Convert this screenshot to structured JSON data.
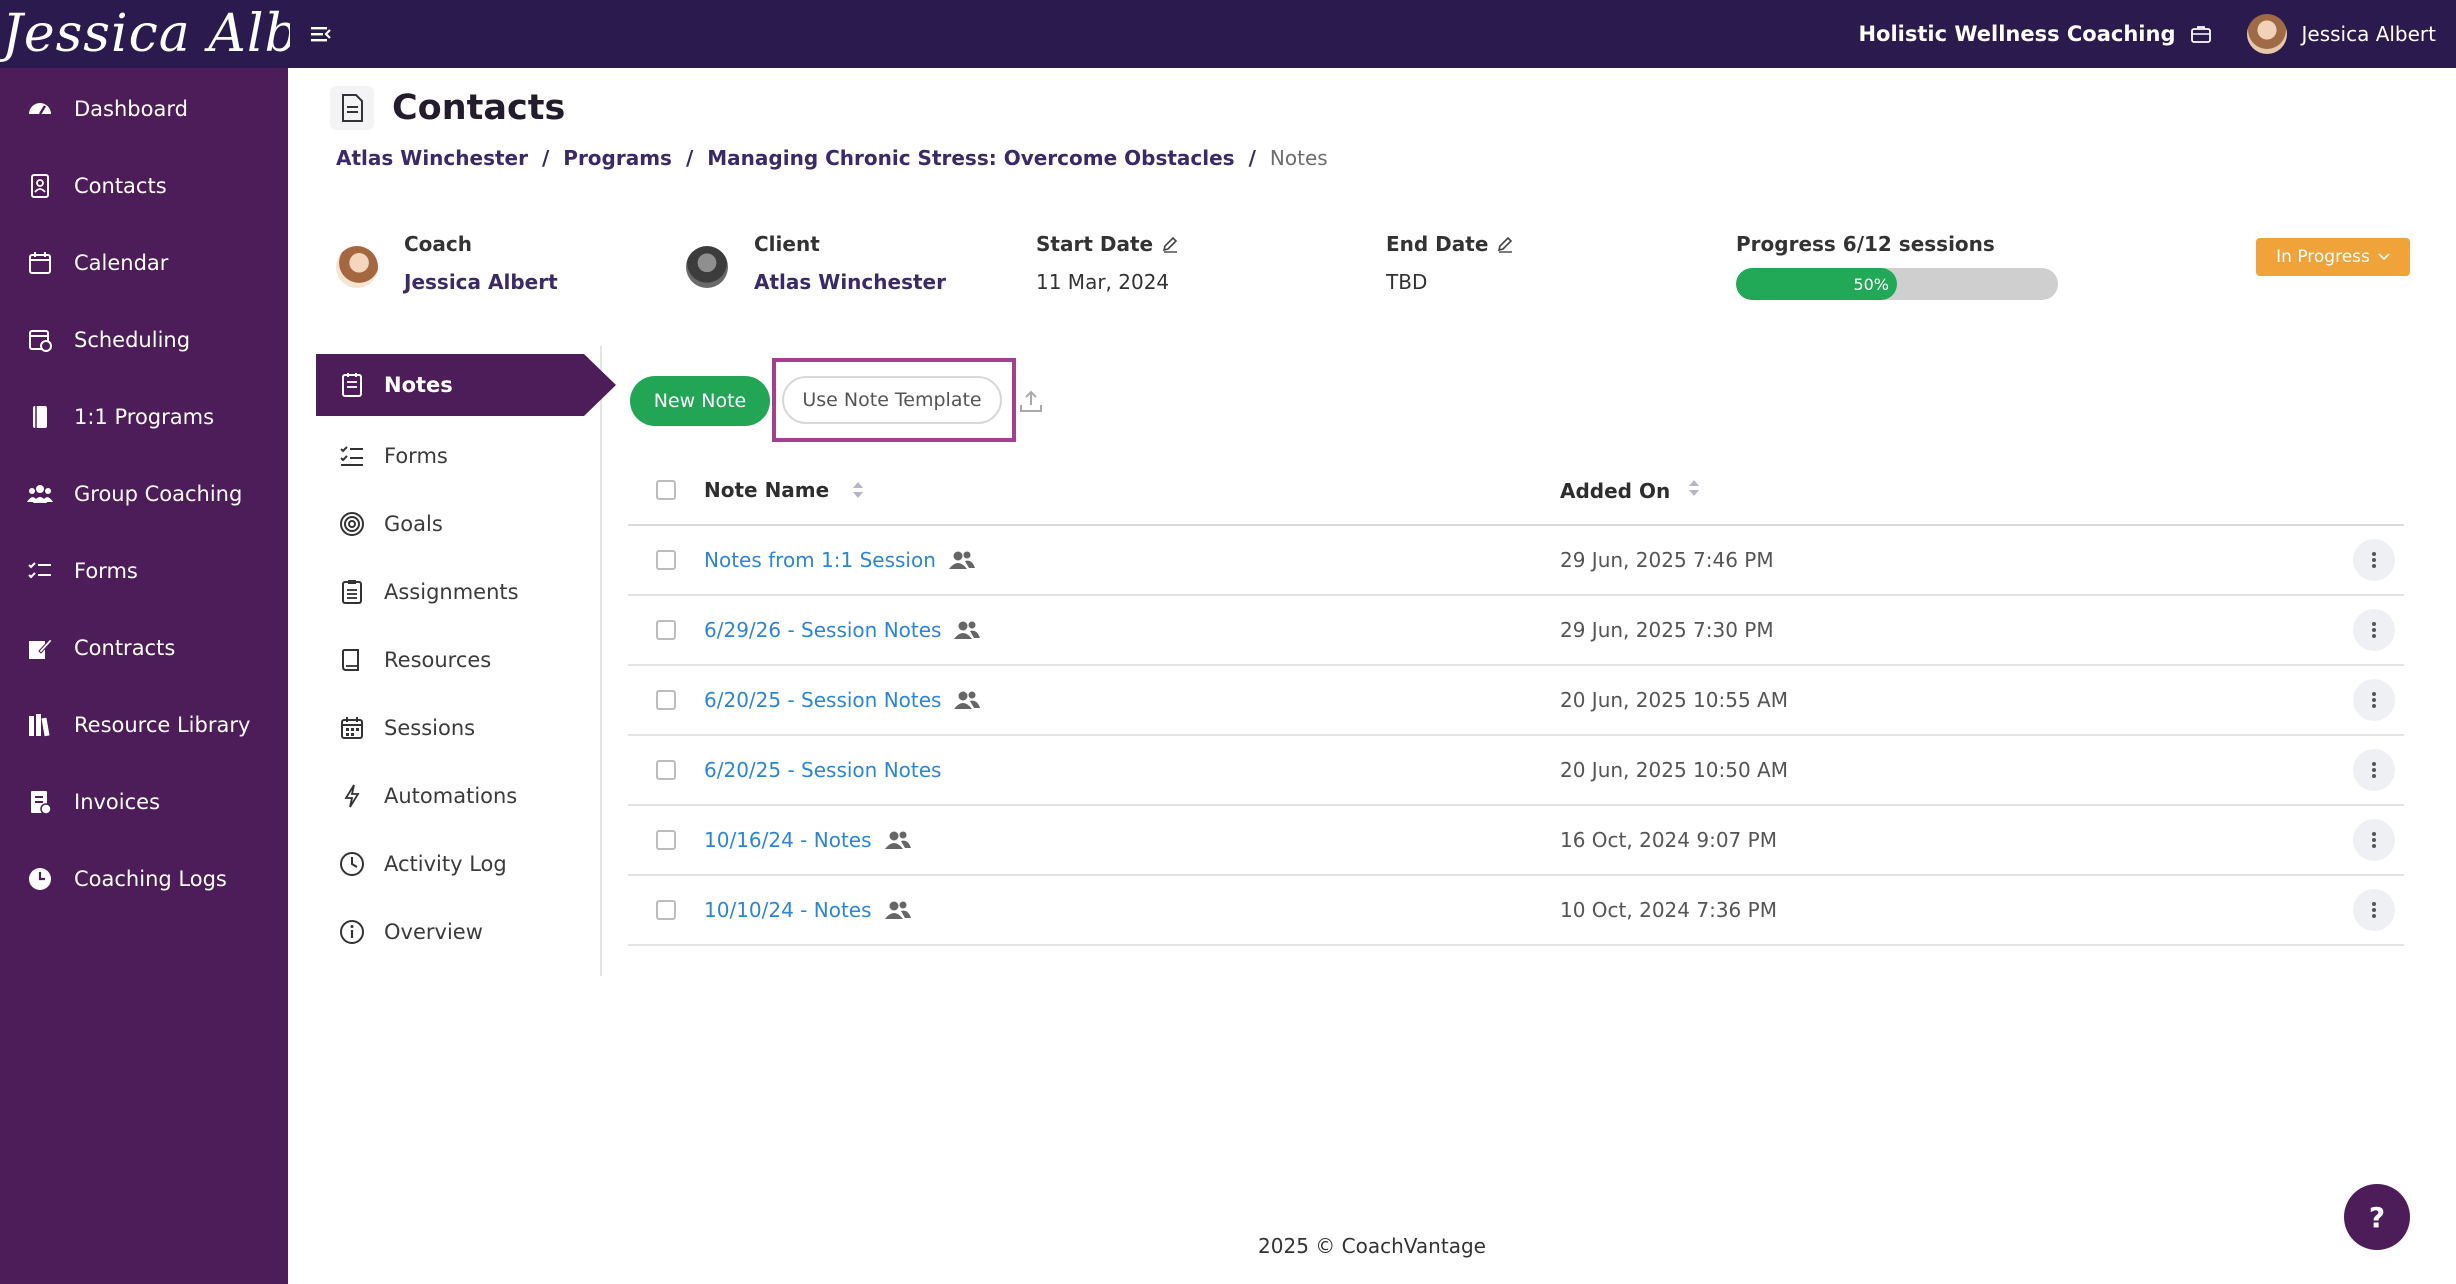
{
  "topbar": {
    "logo_text": "Jessica Albert",
    "org_name": "Holistic Wellness Coaching",
    "user_name": "Jessica Albert"
  },
  "sidebar": {
    "items": [
      {
        "label": "Dashboard",
        "icon": "dashboard-icon"
      },
      {
        "label": "Contacts",
        "icon": "contacts-icon"
      },
      {
        "label": "Calendar",
        "icon": "calendar-icon"
      },
      {
        "label": "Scheduling",
        "icon": "scheduling-icon"
      },
      {
        "label": "1:1 Programs",
        "icon": "book-icon"
      },
      {
        "label": "Group Coaching",
        "icon": "group-icon"
      },
      {
        "label": "Forms",
        "icon": "forms-icon"
      },
      {
        "label": "Contracts",
        "icon": "contract-icon"
      },
      {
        "label": "Resource Library",
        "icon": "library-icon"
      },
      {
        "label": "Invoices",
        "icon": "invoice-icon"
      },
      {
        "label": "Coaching Logs",
        "icon": "clock-icon"
      }
    ]
  },
  "page": {
    "title": "Contacts",
    "breadcrumb": [
      "Atlas Winchester",
      "Programs",
      "Managing Chronic Stress: Overcome Obstacles",
      "Notes"
    ],
    "separator": "/"
  },
  "info": {
    "coach_label": "Coach",
    "coach_name": "Jessica Albert",
    "client_label": "Client",
    "client_name": "Atlas Winchester",
    "start_label": "Start Date",
    "start_value": "11 Mar, 2024",
    "end_label": "End Date",
    "end_value": "TBD",
    "progress_label": "Progress 6/12 sessions",
    "progress_text": "50%",
    "progress_value": 0.5,
    "status": "In Progress"
  },
  "subnav": {
    "items": [
      {
        "label": "Notes",
        "icon": "notes-icon",
        "active": true
      },
      {
        "label": "Forms",
        "icon": "checklist-icon"
      },
      {
        "label": "Goals",
        "icon": "target-icon"
      },
      {
        "label": "Assignments",
        "icon": "clipboard-icon"
      },
      {
        "label": "Resources",
        "icon": "resources-icon"
      },
      {
        "label": "Sessions",
        "icon": "calendar-icon"
      },
      {
        "label": "Automations",
        "icon": "lightning-icon"
      },
      {
        "label": "Activity Log",
        "icon": "history-icon"
      },
      {
        "label": "Overview",
        "icon": "info-icon"
      }
    ]
  },
  "toolbar": {
    "new_note": "New Note",
    "use_template": "Use Note Template"
  },
  "table": {
    "headers": {
      "name": "Note Name",
      "added": "Added On"
    },
    "rows": [
      {
        "name": "Notes from 1:1 Session",
        "added": "29 Jun, 2025 7:46 PM",
        "shared": true
      },
      {
        "name": "6/29/26 - Session Notes",
        "added": "29 Jun, 2025 7:30 PM",
        "shared": true
      },
      {
        "name": "6/20/25 - Session Notes",
        "added": "20 Jun, 2025 10:55 AM",
        "shared": true
      },
      {
        "name": "6/20/25 - Session Notes",
        "added": "20 Jun, 2025 10:50 AM",
        "shared": false
      },
      {
        "name": "10/16/24 - Notes",
        "added": "16 Oct, 2024 9:07 PM",
        "shared": true
      },
      {
        "name": "10/10/24 - Notes",
        "added": "10 Oct, 2024 7:36 PM",
        "shared": true
      }
    ]
  },
  "footer": {
    "text": "2025 © CoachVantage"
  },
  "help": {
    "label": "?"
  },
  "colors": {
    "topbar": "#2a1a4e",
    "sidebar": "#4d1d5a",
    "primary_green": "#22a655",
    "status_orange": "#f0a338",
    "link_blue": "#2b86d8",
    "highlight": "#a4408f"
  }
}
